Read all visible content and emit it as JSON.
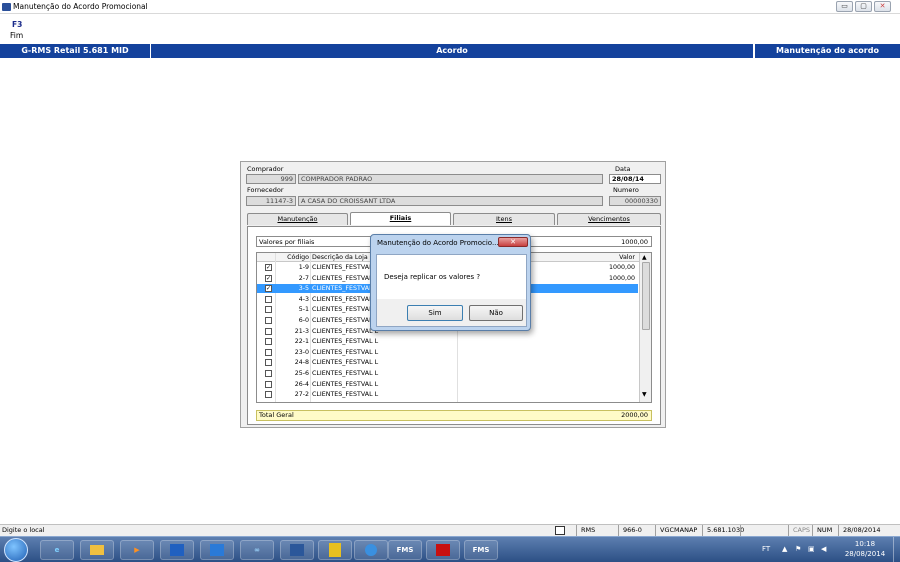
{
  "window": {
    "title": "Manutenção do Acordo Promocional",
    "controls": [
      "▭",
      "▢",
      "✕"
    ]
  },
  "toolbar": {
    "key": "F3",
    "label": "Fim"
  },
  "banner": {
    "left": "G-RMS Retail 5.681 MID",
    "center": "Acordo",
    "right": "Manutenção do acordo"
  },
  "form": {
    "comprador_label": "Comprador",
    "comprador_code": "999",
    "comprador_name": "COMPRADOR PADRAO",
    "data_label": "Data",
    "data_value": "28/08/14",
    "fornecedor_label": "Fornecedor",
    "fornecedor_code": "11147-3",
    "fornecedor_name": "A CASA DO CROISSANT LTDA",
    "numero_label": "Numero",
    "numero_value": "00000330"
  },
  "tabs": [
    "Manutenção",
    "Filiais",
    "Itens",
    "Vencimentos"
  ],
  "panel": {
    "valores_label": "Valores por filiais",
    "valores_value": "1000,00",
    "col_code": "Código",
    "col_desc": "Descrição da Loja",
    "col_valor": "Valor",
    "total_label": "Total Geral",
    "total_value": "2000,00"
  },
  "rows": [
    {
      "checked": true,
      "code": "1-9",
      "desc": "CLIENTES_FESTVAL L",
      "valor": "1000,00",
      "selected": false
    },
    {
      "checked": true,
      "code": "2-7",
      "desc": "CLIENTES_FESTVAL L",
      "valor": "1000,00",
      "selected": false
    },
    {
      "checked": true,
      "code": "3-5",
      "desc": "CLIENTES_FESTVAL L",
      "valor": "",
      "selected": true
    },
    {
      "checked": false,
      "code": "4-3",
      "desc": "CLIENTES_FESTVAL L",
      "valor": "",
      "selected": false
    },
    {
      "checked": false,
      "code": "5-1",
      "desc": "CLIENTES_FESTVAL L",
      "valor": "",
      "selected": false
    },
    {
      "checked": false,
      "code": "6-0",
      "desc": "CLIENTES_FESTVAL L",
      "valor": "",
      "selected": false
    },
    {
      "checked": false,
      "code": "21-3",
      "desc": "CLIENTES_FESTVAL L",
      "valor": "",
      "selected": false
    },
    {
      "checked": false,
      "code": "22-1",
      "desc": "CLIENTES_FESTVAL L",
      "valor": "",
      "selected": false
    },
    {
      "checked": false,
      "code": "23-0",
      "desc": "CLIENTES_FESTVAL L",
      "valor": "",
      "selected": false
    },
    {
      "checked": false,
      "code": "24-8",
      "desc": "CLIENTES_FESTVAL L",
      "valor": "",
      "selected": false
    },
    {
      "checked": false,
      "code": "25-6",
      "desc": "CLIENTES_FESTVAL L",
      "valor": "",
      "selected": false
    },
    {
      "checked": false,
      "code": "26-4",
      "desc": "CLIENTES_FESTVAL L",
      "valor": "",
      "selected": false
    },
    {
      "checked": false,
      "code": "27-2",
      "desc": "CLIENTES_FESTVAL L",
      "valor": "",
      "selected": false
    }
  ],
  "dialog": {
    "title": "Manutenção do Acordo Promocio...",
    "message": "Deseja replicar os valores ?",
    "yes": "Sim",
    "no": "Não"
  },
  "status": {
    "hint": "Digite o local",
    "rms": "RMS",
    "code": "966-0",
    "user": "VGCMANAP",
    "version": "5.681.1030",
    "caps": "CAPS",
    "num": "NUM",
    "date": "28/08/2014"
  },
  "taskbar": {
    "apps": [
      "FMS",
      "FMS"
    ],
    "lang": "FT",
    "time": "10:18",
    "date": "28/08/2014"
  },
  "colors": {
    "banner": "#14429c",
    "selection": "#3399ff",
    "total_bg": "#fffbc8"
  }
}
